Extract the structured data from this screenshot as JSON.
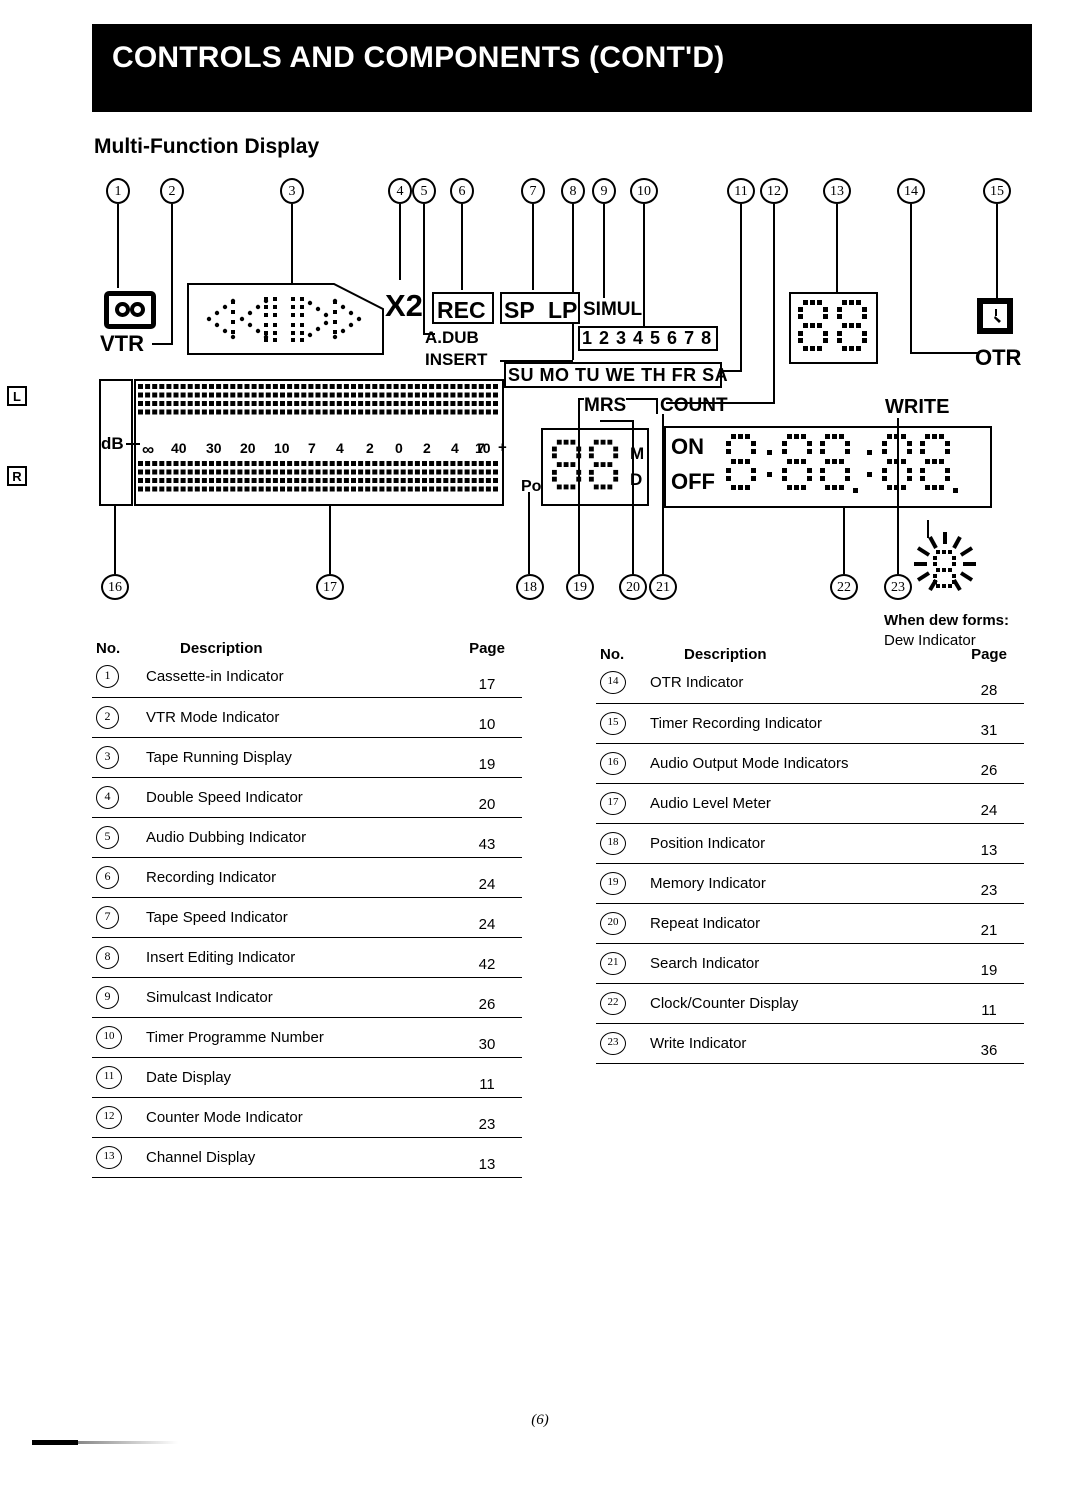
{
  "page": {
    "banner_title": "CONTROLS AND COMPONENTS (CONT'D)",
    "section_title": "Multi-Function Display",
    "footer": "(6)"
  },
  "display": {
    "vtr_label": "VTR",
    "double_speed_label": "X2",
    "rec_label": "REC",
    "sp_label": "SP",
    "lp_label": "LP",
    "adub_label": "A.DUB",
    "insert_label": "INSERT",
    "simul_label": "SIMUL",
    "timer_prog_numbers": "1 2 3 4 5 6 7 8",
    "weekdays": [
      "SU",
      "MO",
      "TU",
      "WE",
      "TH",
      "FR",
      "SA"
    ],
    "mrs_label": "MRS",
    "count_label": "COUNT",
    "write_label": "WRITE",
    "otr_label": "OTR",
    "position_label": "Po",
    "counter_mode_m": "M",
    "counter_mode_d": "D",
    "on_label": "ON",
    "off_label": "OFF",
    "channel_digits": "88",
    "position_digits": "88",
    "clock_digits": "8:88.:88.",
    "db_label": "dB",
    "left_channel": "L",
    "right_channel": "R",
    "db_scale": [
      "∞",
      "40",
      "30",
      "20",
      "10",
      "7",
      "4",
      "2",
      "0",
      "2",
      "4",
      "7",
      "10",
      "+"
    ],
    "dew_note_line1": "When dew forms:",
    "dew_note_line2": "Dew Indicator"
  },
  "callouts_top": [
    "1",
    "2",
    "3",
    "4",
    "5",
    "6",
    "7",
    "8",
    "9",
    "10",
    "11",
    "12",
    "13",
    "14",
    "15"
  ],
  "callouts_bottom": [
    "16",
    "17",
    "18",
    "19",
    "20",
    "21",
    "22",
    "23"
  ],
  "table_left": {
    "headers": {
      "no": "No.",
      "description": "Description",
      "page": "Page"
    },
    "rows": [
      {
        "no": "1",
        "description": "Cassette-in Indicator",
        "page": "17"
      },
      {
        "no": "2",
        "description": "VTR Mode Indicator",
        "page": "10"
      },
      {
        "no": "3",
        "description": "Tape Running Display",
        "page": "19"
      },
      {
        "no": "4",
        "description": "Double Speed Indicator",
        "page": "20"
      },
      {
        "no": "5",
        "description": "Audio Dubbing Indicator",
        "page": "43"
      },
      {
        "no": "6",
        "description": "Recording Indicator",
        "page": "24"
      },
      {
        "no": "7",
        "description": "Tape Speed Indicator",
        "page": "24"
      },
      {
        "no": "8",
        "description": "Insert Editing Indicator",
        "page": "42"
      },
      {
        "no": "9",
        "description": "Simulcast Indicator",
        "page": "26"
      },
      {
        "no": "10",
        "description": "Timer Programme Number",
        "page": "30"
      },
      {
        "no": "11",
        "description": "Date Display",
        "page": "11"
      },
      {
        "no": "12",
        "description": "Counter Mode Indicator",
        "page": "23"
      },
      {
        "no": "13",
        "description": "Channel Display",
        "page": "13"
      }
    ]
  },
  "table_right": {
    "headers": {
      "no": "No.",
      "description": "Description",
      "page": "Page"
    },
    "rows": [
      {
        "no": "14",
        "description": "OTR Indicator",
        "page": "28"
      },
      {
        "no": "15",
        "description": "Timer Recording Indicator",
        "page": "31"
      },
      {
        "no": "16",
        "description": "Audio Output Mode Indicators",
        "page": "26"
      },
      {
        "no": "17",
        "description": "Audio Level Meter",
        "page": "24"
      },
      {
        "no": "18",
        "description": "Position Indicator",
        "page": "13"
      },
      {
        "no": "19",
        "description": "Memory Indicator",
        "page": "23"
      },
      {
        "no": "20",
        "description": "Repeat Indicator",
        "page": "21"
      },
      {
        "no": "21",
        "description": "Search Indicator",
        "page": "19"
      },
      {
        "no": "22",
        "description": "Clock/Counter Display",
        "page": "11"
      },
      {
        "no": "23",
        "description": "Write Indicator",
        "page": "36"
      }
    ]
  }
}
